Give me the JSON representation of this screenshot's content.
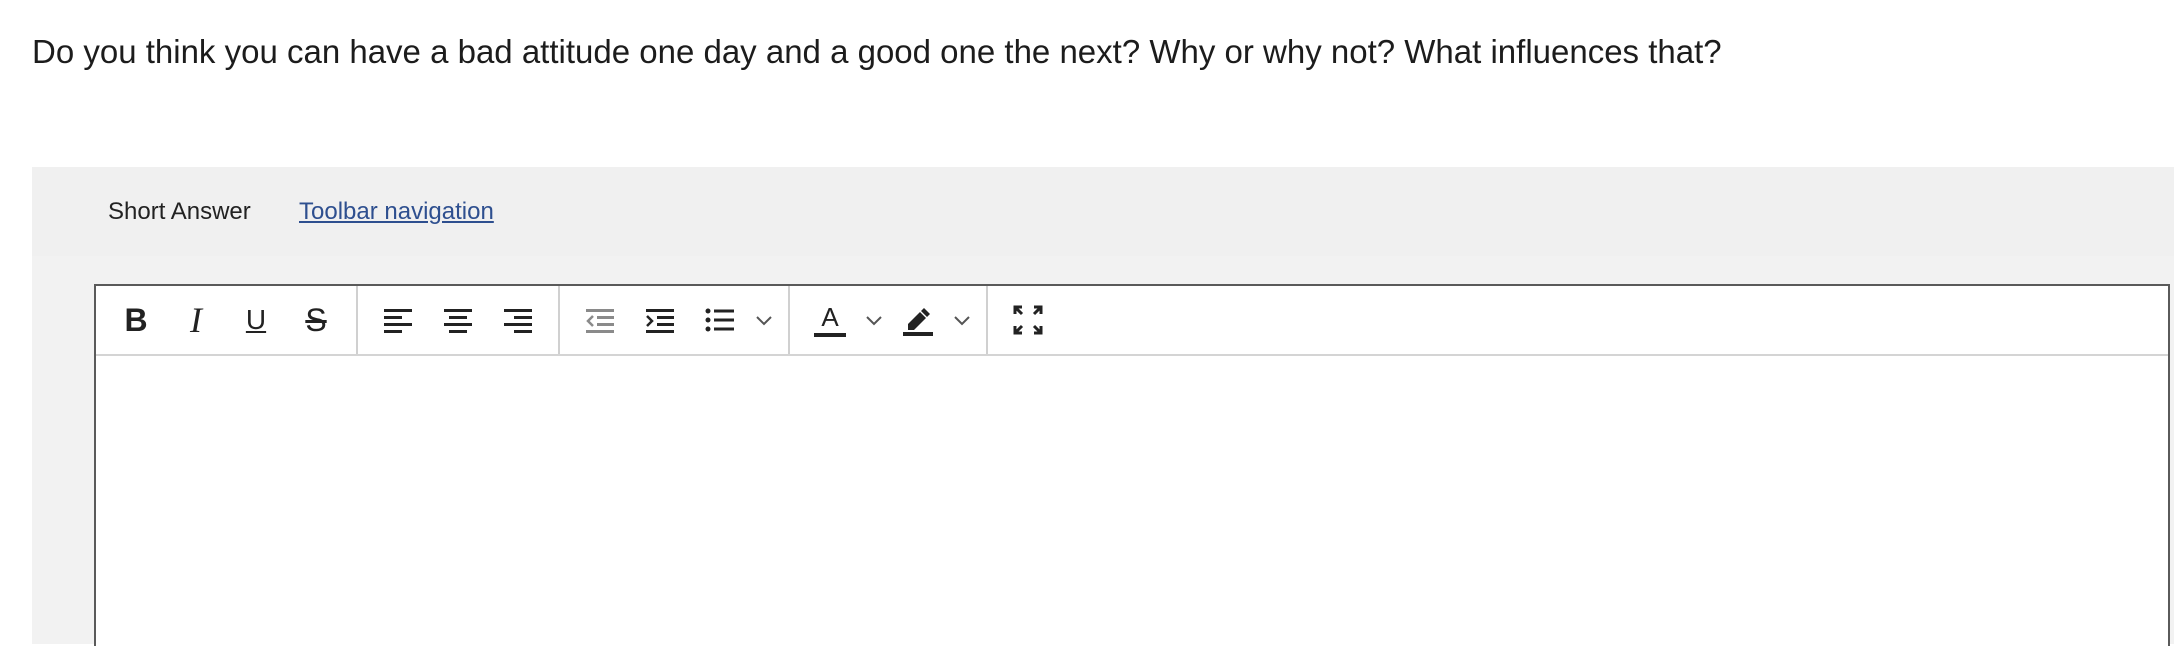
{
  "question": {
    "text": "Do you think you can have a bad attitude one day and a good one the next? Why or why not? What influences that?"
  },
  "answer": {
    "type_label": "Short Answer",
    "toolbar_nav_link": "Toolbar navigation"
  },
  "toolbar": {
    "bold_glyph": "B",
    "italic_glyph": "I",
    "underline_glyph": "U",
    "strikethrough_glyph": "S",
    "text_color_glyph": "A",
    "icons": [
      "bold-icon",
      "italic-icon",
      "underline-icon",
      "strikethrough-icon",
      "align-left-icon",
      "align-center-icon",
      "align-right-icon",
      "outdent-icon",
      "indent-icon",
      "bulleted-list-icon",
      "chevron-down-icon",
      "text-color-icon",
      "chevron-down-icon",
      "highlight-icon",
      "chevron-down-icon",
      "fullscreen-icon"
    ]
  },
  "colors": {
    "link": "#2e4f8f",
    "panel_bg": "#f0f0f0",
    "icon": "#222222",
    "icon_disabled": "#8a8a8a"
  }
}
